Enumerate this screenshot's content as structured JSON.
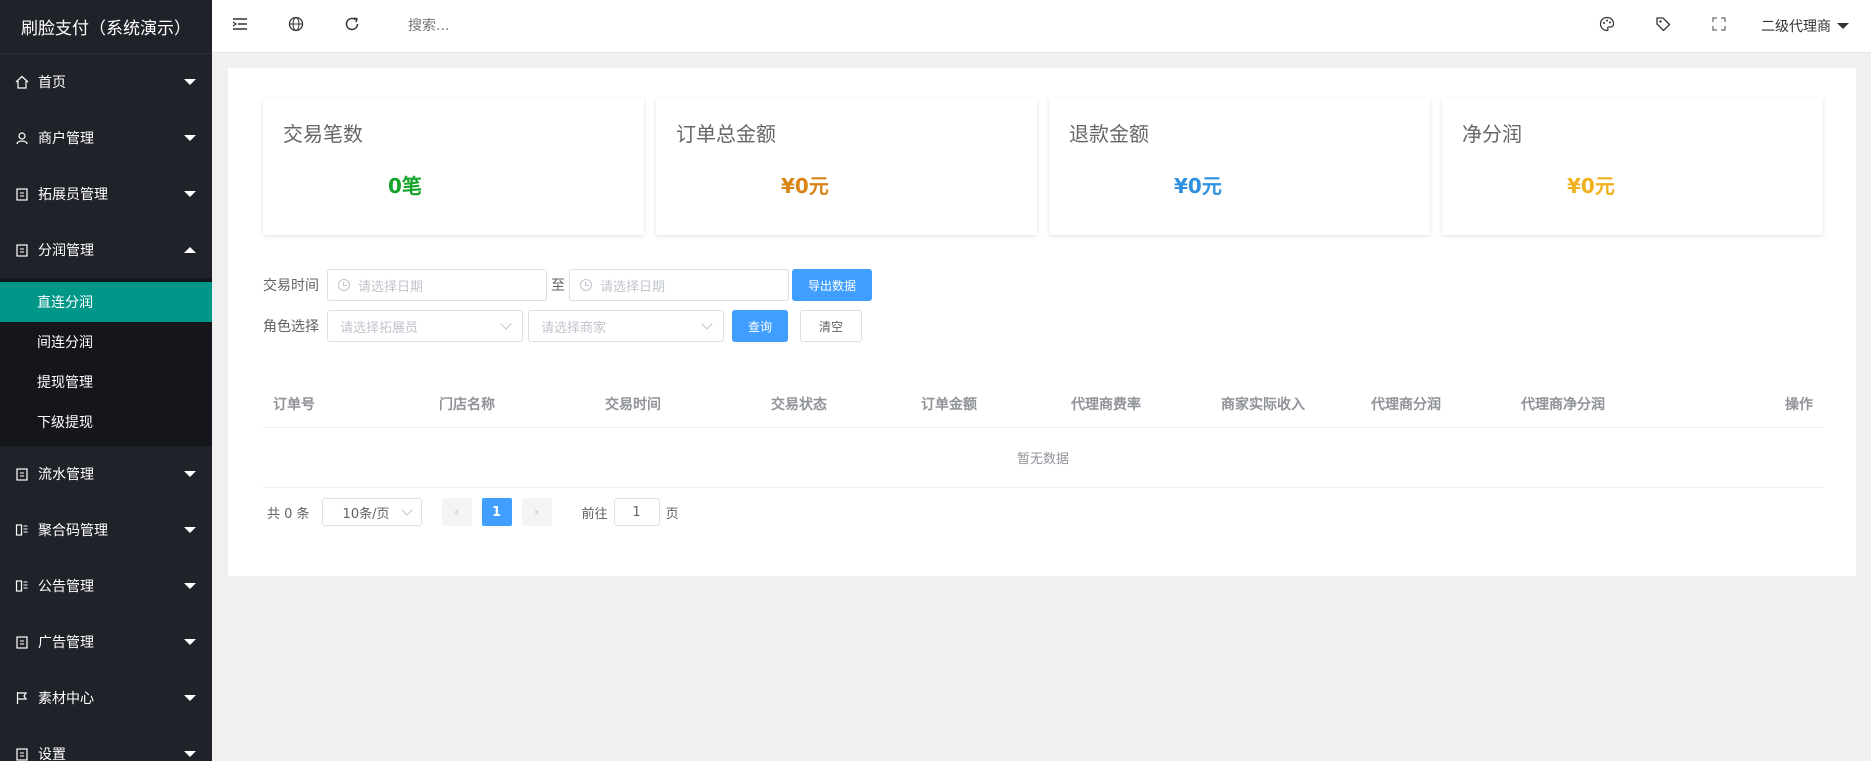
{
  "app": {
    "title": "刷脸支付（系统演示）"
  },
  "sidebar": {
    "items": [
      {
        "label": "首页",
        "icon": "home-icon"
      },
      {
        "label": "商户管理",
        "icon": "user-icon"
      },
      {
        "label": "拓展员管理",
        "icon": "clipboard-icon"
      },
      {
        "label": "分润管理",
        "icon": "clipboard-icon",
        "expanded": true
      },
      {
        "label": "流水管理",
        "icon": "clipboard-icon"
      },
      {
        "label": "聚合码管理",
        "icon": "qrcode-icon"
      },
      {
        "label": "公告管理",
        "icon": "qrcode-icon"
      },
      {
        "label": "广告管理",
        "icon": "clipboard-icon"
      },
      {
        "label": "素材中心",
        "icon": "flag-icon"
      },
      {
        "label": "设置",
        "icon": "clipboard-icon"
      }
    ],
    "submenu": [
      {
        "label": "直连分润",
        "active": true
      },
      {
        "label": "间连分润"
      },
      {
        "label": "提现管理"
      },
      {
        "label": "下级提现"
      }
    ]
  },
  "header": {
    "search_placeholder": "搜索...",
    "user": "二级代理商"
  },
  "stats": [
    {
      "title": "交易笔数",
      "value": "0笔",
      "color": "#15a32a"
    },
    {
      "title": "订单总金额",
      "value": "¥0元",
      "color": "#d98516"
    },
    {
      "title": "退款金额",
      "value": "¥0元",
      "color": "#2f8fe0"
    },
    {
      "title": "净分润",
      "value": "¥0元",
      "color": "#f0b11e"
    }
  ],
  "filters": {
    "time_label": "交易时间",
    "date_placeholder": "请选择日期",
    "to_label": "至",
    "export_label": "导出数据",
    "role_label": "角色选择",
    "expander_placeholder": "请选择拓展员",
    "merchant_placeholder": "请选择商家",
    "query_label": "查询",
    "clear_label": "清空"
  },
  "table": {
    "columns": [
      "订单号",
      "门店名称",
      "交易时间",
      "交易状态",
      "订单金额",
      "代理商费率",
      "商家实际收入",
      "代理商分润",
      "代理商净分润",
      "操作"
    ],
    "empty_text": "暂无数据"
  },
  "pagination": {
    "total_text": "共 0 条",
    "page_size": "10条/页",
    "current_page": "1",
    "goto_label": "前往",
    "goto_value": "1",
    "page_suffix": "页"
  }
}
